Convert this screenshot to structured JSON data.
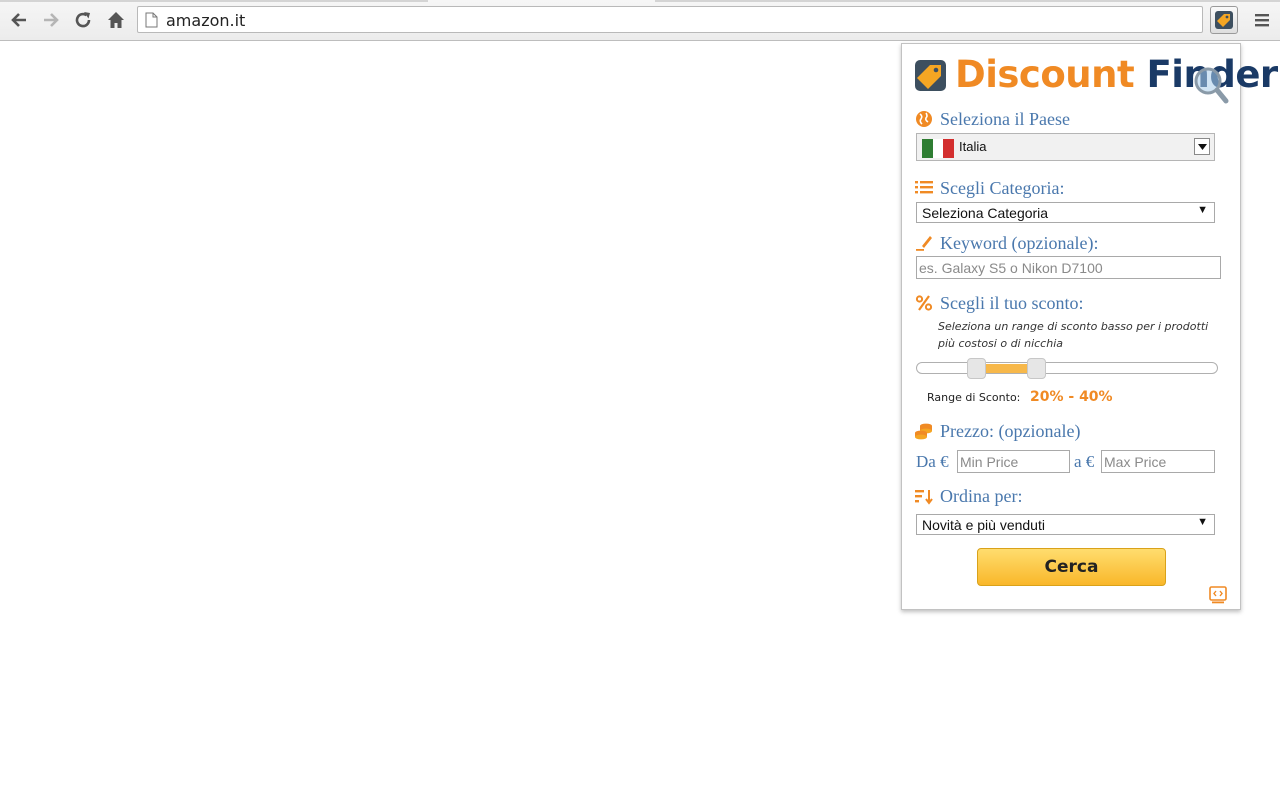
{
  "browser": {
    "url": "amazon.it",
    "icons": {
      "back": "arrow-left-icon",
      "forward": "arrow-right-icon",
      "reload": "reload-icon",
      "home": "home-icon",
      "page": "page-icon",
      "extension": "price-tag-icon",
      "menu": "hamburger-menu-icon"
    }
  },
  "popup": {
    "logo": {
      "word1": "Discount",
      "word2": "Finder"
    },
    "country": {
      "label": "Seleziona il Paese",
      "selected": "Italia",
      "icon": "globe-icon"
    },
    "category": {
      "label": "Scegli Categoria:",
      "selected": "Seleziona Categoria",
      "icon": "list-icon"
    },
    "keyword": {
      "label": "Keyword (opzionale):",
      "placeholder": "es. Galaxy S5 o Nikon D7100",
      "value": "",
      "icon": "pencil-icon"
    },
    "discount": {
      "label": "Scegli il tuo sconto:",
      "hint": "Seleziona un range di sconto basso per i prodotti più costosi o di nicchia",
      "range_label": "Range di Sconto:",
      "range_text": "20% - 40%",
      "min_percent": 20,
      "max_percent": 40,
      "icon": "percent-icon"
    },
    "price": {
      "label": "Prezzo: (opzionale)",
      "from_label": "Da €",
      "to_label": "a €",
      "min_placeholder": "Min Price",
      "max_placeholder": "Max Price",
      "icon": "coins-icon"
    },
    "sort": {
      "label": "Ordina per:",
      "selected": "Novità e più venduti",
      "icon": "sort-icon"
    },
    "search_button": "Cerca",
    "colors": {
      "accent_orange": "#f08a24",
      "label_blue": "#4a78ad",
      "logo_navy": "#1a3a66",
      "button_yellow": "#f9b72a"
    }
  }
}
